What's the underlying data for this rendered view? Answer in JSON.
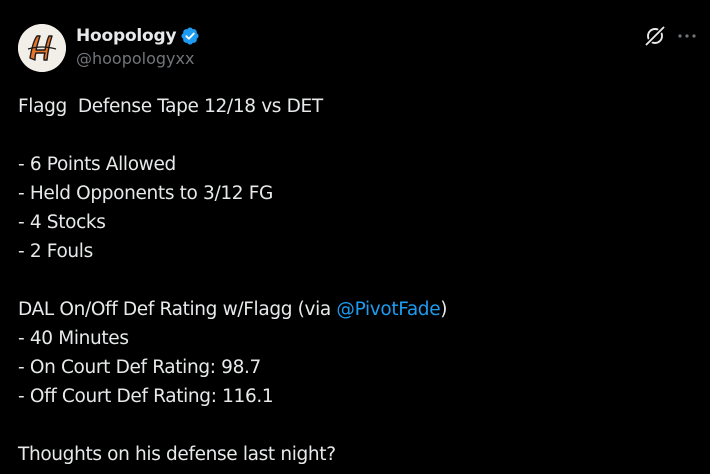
{
  "author": {
    "display_name": "Hoopology",
    "handle": "@hoopologyxx",
    "verified": true,
    "avatar_letter": "H",
    "avatar_icon": "hoopology-logo-icon"
  },
  "header_actions": {
    "grok_icon": "grok-icon",
    "more_icon": "more-icon"
  },
  "post": {
    "line_1": "Flagg  Defense Tape 12/18 vs DET",
    "stats": [
      "- 6 Points Allowed",
      "- Held Opponents to 3/12 FG",
      "- 4 Stocks",
      "- 2 Fouls"
    ],
    "onoff_prefix": "DAL On/Off Def Rating w/Flagg (via ",
    "mention": "@PivotFade",
    "onoff_suffix": ")",
    "onoff_stats": [
      "- 40 Minutes",
      "- On Court Def Rating: 98.7",
      "- Off Court Def Rating: 116.1"
    ],
    "closing": "Thoughts on his defense last night?"
  },
  "colors": {
    "background": "#000000",
    "text": "#e7e9ea",
    "secondary": "#71767b",
    "accent": "#1d9bf0",
    "avatar_orange": "#e8742a"
  }
}
